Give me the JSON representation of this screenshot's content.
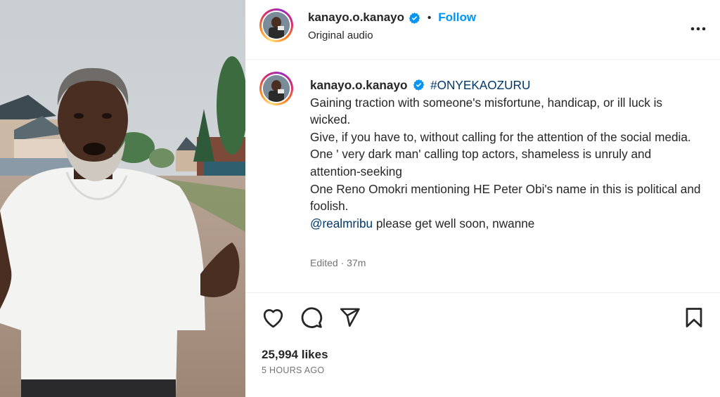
{
  "header": {
    "username": "kanayo.o.kanayo",
    "separator": "•",
    "follow_label": "Follow",
    "subtitle": "Original audio",
    "more_label": "..."
  },
  "caption": {
    "username": "kanayo.o.kanayo",
    "hashtag": "#ONYEKAOZURU",
    "lines": [
      "Gaining traction with someone's misfortune, handicap, or ill luck is wicked.",
      "Give, if you have to, without calling for the attention of the social media.",
      "One ' very dark man' calling top actors, shameless is unruly and attention-seeking",
      "One Reno Omokri mentioning HE Peter Obi's name in this is political and foolish."
    ],
    "mention": "@realmribu",
    "mention_rest": " please get well soon, nwanne",
    "meta": "Edited · 37m"
  },
  "footer": {
    "likes": "25,994 likes",
    "time": "5 HOURS AGO"
  },
  "icons": {
    "like": "heart-icon",
    "comment": "comment-icon",
    "share": "share-icon",
    "save": "bookmark-icon",
    "verified": "verified-badge-icon"
  },
  "colors": {
    "link": "#0095f6",
    "hashtag": "#00376b",
    "verified": "#0095f6",
    "muted": "#737373"
  }
}
